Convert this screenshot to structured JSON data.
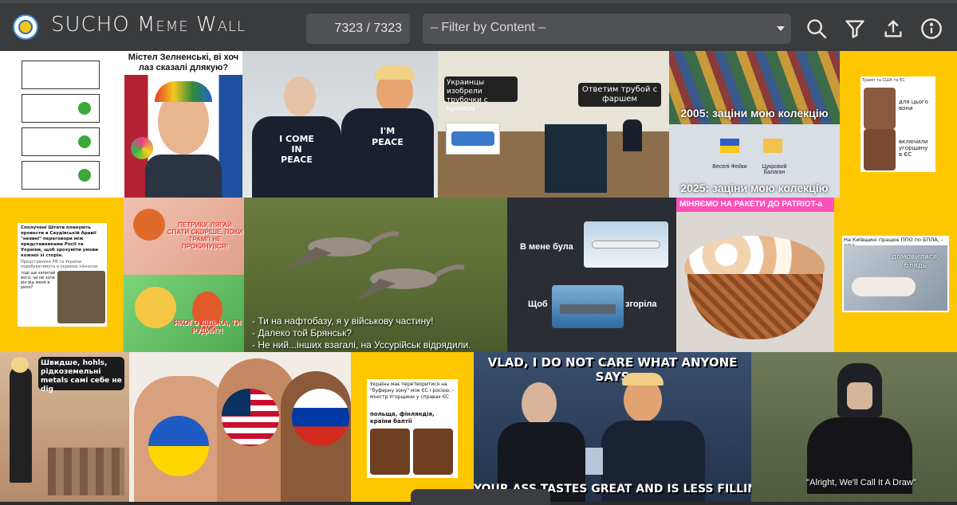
{
  "header": {
    "title_prefix": "SUCHO ",
    "title_word1": "Meme",
    "title_word2": "Wall",
    "counter": "7323 / 7323",
    "filter_placeholder": "– Filter by Content –",
    "icons": [
      "search-icon",
      "filter-icon",
      "upload-icon",
      "info-icon"
    ]
  },
  "tiles": {
    "zelensky_caption": "Містел Зелненські, ві хоч лаз сказалі длякую?",
    "putin_shirt": "I COME IN PEACE",
    "trump_shirt": "I'M PEACE",
    "pipe_bubble1": "Украинцы изобрели трубочки с кремом",
    "pipe_bubble2": "Ответим трубой с фаршем",
    "collection_2005": "2005: заціни мою колекцію",
    "collection_2025": "2025: заціни мою колекцію",
    "folder1": "Веселі Фейки",
    "folder2": "Цукровий Балаган",
    "small_header": "Трамп та США та ЄС",
    "small_bubble1": "для цього вони",
    "small_bubble2": "включили угорщину в ЄС",
    "saudi_text": "Сполучені Штати планують провести в Саудівській Аравії \"неявні\" переговори між представниками Росії та України, щоб зрозуміти умови кожної зі сторін.",
    "saudi_sub": "Представники РФ та України перебуватимуть в окремих кімнатах",
    "saudi_q": "тоді ще запитай його, чи не хоче він від мене в рило?",
    "cartoon_top": "ПЕТРИКУ, ЛЯГАЙ СПАТИ СКОРІШЕ, ПОКИ ТРАМП НЕ ПРОКИНУВСЯ!",
    "cartoon_bottom": "ЯКОГО ДІДЬКА, ТИ РУДИЙ?!",
    "geese_line1": "- Ти на нафтобазу, я у військову частину!",
    "geese_line2": "- Далеко той Брянськ?",
    "geese_line3": "- Не ний...інших взагалі, на Уссурійськ відрядили.",
    "plane_text": "В мене була",
    "ship_text1": "Щоб",
    "ship_text2": "згоріла",
    "eggs_caption": "МІНЯЄМО НА РАКЕТИ ДО PATRIOT-а",
    "kyiv_header": "На Київщині працює ППО по БПЛА, - ОВА",
    "kyiv_bubble": "домовилися, блядь",
    "metals_bubble": "Швидше, hohls, рідкоземельні metals самі себе не dig",
    "buffer_text": "Україна має перетворитися на \"буферну зону\" між ЄС і росією, - міністр Угорщини у справах ЄС",
    "buffer_sub": "польща, фінляндія, країни балтії",
    "vlad_top": "VLAD, I DO NOT CARE WHAT ANYONE SAYS",
    "vlad_bottom": "YOUR ASS TASTES GREAT AND IS LESS FILLING",
    "knight_caption": "\"Alright, We'll Call It A Draw\""
  },
  "colors": {
    "accent_yellow": "#ffc700",
    "header_bg": "#3a3b3d"
  }
}
